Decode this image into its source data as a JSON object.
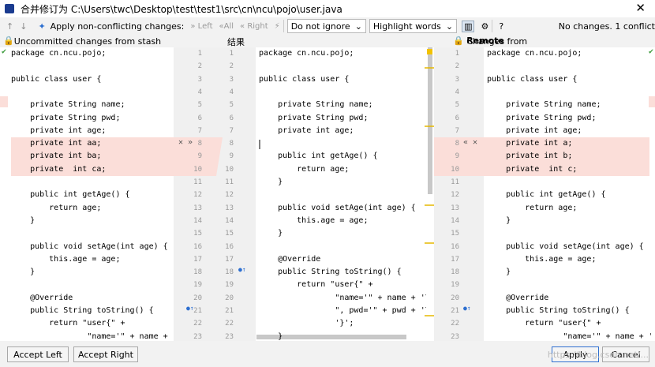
{
  "window": {
    "title": "合并修订为 C:\\Users\\twc\\Desktop\\test\\test1\\src\\cn\\ncu\\pojo\\user.java",
    "close": "✕"
  },
  "toolbar": {
    "up": "↑",
    "down": "↓",
    "magic_label": "Apply non-conflicting changes:",
    "left": "» Left",
    "all": "«All",
    "right": "« Right",
    "ignore": "Do not ignore",
    "highlight": "Highlight words",
    "settings": "⚙",
    "help": "?",
    "status": "No changes. 1 conflict"
  },
  "headers": {
    "left": "Uncommitted changes from stash",
    "middle": "结果",
    "right_prefix": "Changes from ",
    "right_bold": "Remote"
  },
  "footer": {
    "accept_left": "Accept Left",
    "accept_right": "Accept Right",
    "apply": "Apply",
    "cancel": "Cancel",
    "watermark": "https://blog.csdn.net/..."
  },
  "left_lines": [
    "package cn.ncu.pojo;",
    "",
    "public class user {",
    "",
    "    private String name;",
    "    private String pwd;",
    "    private int age;",
    "    private int aa;",
    "    private int ba;",
    "    private  int ca;",
    "",
    "    public int getAge() {",
    "        return age;",
    "    }",
    "",
    "    public void setAge(int age) {",
    "        this.age = age;",
    "    }",
    "",
    "    @Override",
    "    public String toString() {",
    "        return \"user{\" +",
    "                \"name='\" + name + '\\''"
  ],
  "middle_lines": [
    "package cn.ncu.pojo;",
    "",
    "public class user {",
    "",
    "    private String name;",
    "    private String pwd;",
    "    private int age;",
    "",
    "    public int getAge() {",
    "        return age;",
    "    }",
    "",
    "    public void setAge(int age) {",
    "        this.age = age;",
    "    }",
    "",
    "    @Override",
    "    public String toString() {",
    "        return \"user{\" +",
    "                \"name='\" + name + '\\'' +",
    "                \", pwd='\" + pwd + '\\'' +",
    "                '}';",
    "    }"
  ],
  "right_lines": [
    "package cn.ncu.pojo;",
    "",
    "public class user {",
    "",
    "    private String name;",
    "    private String pwd;",
    "    private int age;",
    "    private int a;",
    "    private int b;",
    "    private  int c;",
    "",
    "    public int getAge() {",
    "        return age;",
    "    }",
    "",
    "    public void setAge(int age) {",
    "        this.age = age;",
    "    }",
    "",
    "    @Override",
    "    public String toString() {",
    "        return \"user{\" +",
    "                \"name='\" + name + '\\''"
  ],
  "gutter_left": [
    "1",
    "2",
    "3",
    "4",
    "5",
    "6",
    "7",
    "8",
    "9",
    "10",
    "11",
    "12",
    "13",
    "14",
    "15",
    "16",
    "17",
    "18",
    "19",
    "20",
    "21",
    "22",
    "23"
  ],
  "gutter_mid": [
    "1",
    "2",
    "3",
    "4",
    "5",
    "6",
    "7",
    "8",
    "9",
    "10",
    "11",
    "12",
    "13",
    "14",
    "15",
    "16",
    "17",
    "18",
    "19",
    "20",
    "21",
    "22",
    "23"
  ],
  "gutter_right": [
    "1",
    "2",
    "3",
    "4",
    "5",
    "6",
    "7",
    "8",
    "9",
    "10",
    "11",
    "12",
    "13",
    "14",
    "15",
    "16",
    "17",
    "18",
    "19",
    "20",
    "21",
    "22",
    "23"
  ],
  "icons": {
    "left_conflict": "✕ »",
    "right_conflict": "« ✕",
    "bookmark": "●↑"
  }
}
